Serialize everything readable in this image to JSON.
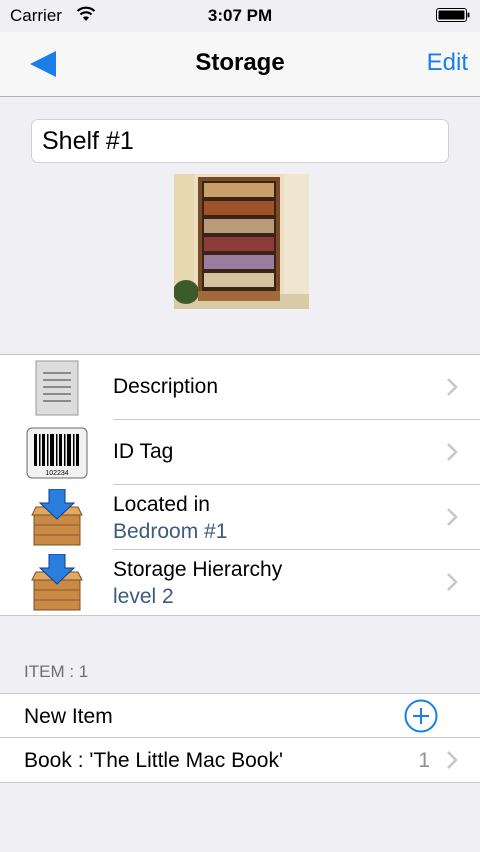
{
  "status_bar": {
    "carrier": "Carrier",
    "time": "3:07 PM",
    "wifi_icon": "wifi-icon",
    "battery_icon": "battery-icon"
  },
  "nav": {
    "title": "Storage",
    "edit_label": "Edit",
    "back_icon": "back-arrow-icon"
  },
  "storage": {
    "name": "Shelf #1",
    "photo": "bookshelf-photo"
  },
  "detail_rows": [
    {
      "icon": "document-icon",
      "label": "Description"
    },
    {
      "icon": "barcode-icon",
      "label": "ID Tag",
      "barcode_text": "102234"
    },
    {
      "icon": "storage-box-icon",
      "label": "Located in",
      "value": "Bedroom #1"
    },
    {
      "icon": "storage-box-icon",
      "label": "Storage Hierarchy",
      "value": "level 2"
    }
  ],
  "items_section": {
    "header": "ITEM : 1",
    "new_item_label": "New Item",
    "add_icon": "add-circle-icon",
    "items": [
      {
        "label": "Book : 'The Little Mac Book'",
        "count": "1"
      }
    ]
  },
  "colors": {
    "accent": "#1a7ee8",
    "subtitle": "#3d5a80",
    "background": "#efeff4"
  }
}
